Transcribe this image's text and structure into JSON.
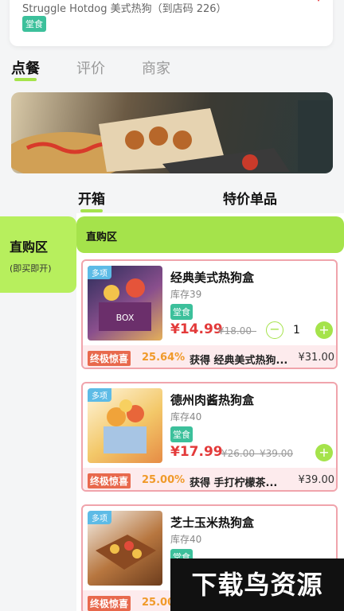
{
  "store": {
    "name": "Struggle Hotdog 美式热狗（到店码 226）",
    "badge": "堂食"
  },
  "main_tabs": [
    {
      "label": "点餐"
    },
    {
      "label": "评价"
    },
    {
      "label": "商家"
    }
  ],
  "sub_tabs": [
    {
      "label": "开箱"
    },
    {
      "label": "特价单品"
    }
  ],
  "sidebar": {
    "title": "直购区",
    "subtitle": "(即买即开)"
  },
  "section": {
    "title": "直购区"
  },
  "products": [
    {
      "multi": "多项",
      "name": "经典美式热狗盒",
      "stock": "库存39",
      "tag": "堂食",
      "price": "¥14.99",
      "original": "¥18.00–",
      "qty": "1",
      "promo_tag": "终极惊喜",
      "promo_pct": "25.64%",
      "promo_text": "获得 经典美式热狗...",
      "promo_price": "¥31.00"
    },
    {
      "multi": "多项",
      "name": "德州肉酱热狗盒",
      "stock": "库存40",
      "tag": "堂食",
      "price": "¥17.99",
      "original": "¥26.00–¥39.00",
      "qty": "",
      "promo_tag": "终极惊喜",
      "promo_pct": "25.00%",
      "promo_text": "获得 手打柠檬茶...",
      "promo_price": "¥39.00"
    },
    {
      "multi": "多项",
      "name": "芝士玉米热狗盒",
      "stock": "库存40",
      "tag": "堂食",
      "price": "",
      "original": "",
      "qty": "",
      "promo_tag": "终极惊喜",
      "promo_pct": "25.00",
      "promo_text": "",
      "promo_price": ""
    }
  ],
  "watermark": "下载鸟资源",
  "colors": {
    "accent": "#a5e34b",
    "price": "#e33a3a",
    "badge": "#3cc09b",
    "promo_bg": "#fdebed",
    "card_border": "#f0a4ac"
  }
}
